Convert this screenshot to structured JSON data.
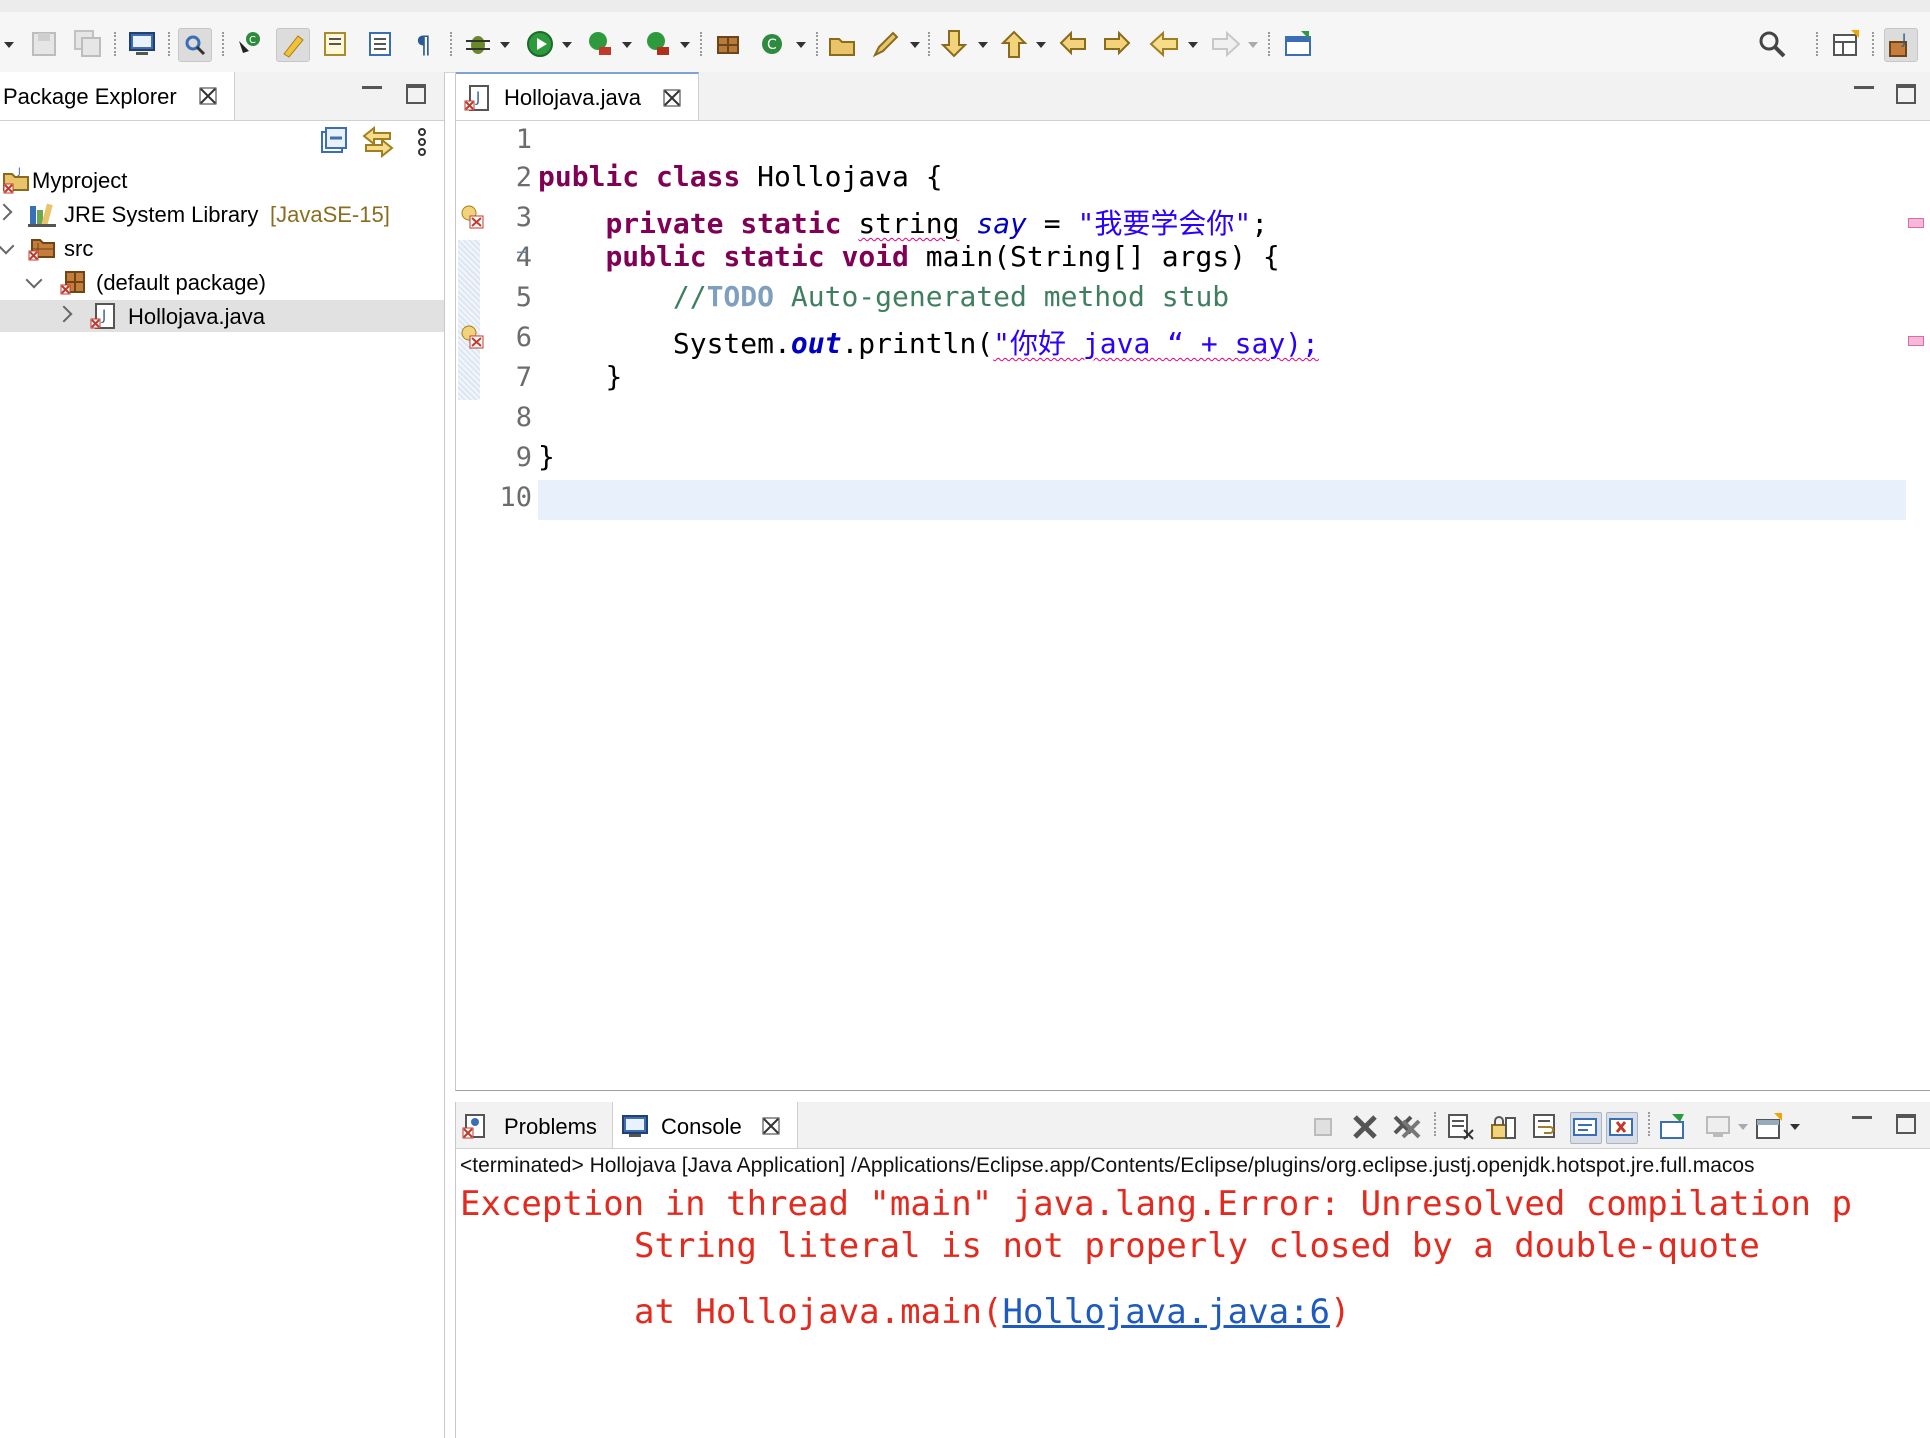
{
  "left_panel": {
    "tab_title": "Package Explorer",
    "tree": [
      {
        "label": "Myproject",
        "suffix": ""
      },
      {
        "label": "JRE System Library",
        "suffix": "[JavaSE-15]"
      },
      {
        "label": "src",
        "suffix": ""
      },
      {
        "label": "(default package)",
        "suffix": ""
      },
      {
        "label": "Hollojava.java",
        "suffix": ""
      }
    ]
  },
  "editor": {
    "tab_title": "Hollojava.java",
    "line_numbers": [
      "1",
      "2",
      "3",
      "4",
      "5",
      "6",
      "7",
      "8",
      "9",
      "10"
    ],
    "fold_marker": "−",
    "line2": {
      "kw1": "public",
      "kw2": "class",
      "rest": " Hollojava {"
    },
    "line3": {
      "kw1": "private",
      "kw2": "static",
      "type": "string",
      "field": "say",
      "op": " = ",
      "string": "\"我要学会你\"",
      "end": ";"
    },
    "line4": {
      "kw1": "public",
      "kw2": "static",
      "kw3": "void",
      "rest": " main(String[] args) {"
    },
    "line5": {
      "comment_start": "//",
      "todo": "TODO",
      "comment": " Auto-generated method stub"
    },
    "line6": {
      "prefix": "System.",
      "field": "out",
      "call": ".println(",
      "bad": "\"你好 java “ + say);"
    },
    "line7": "}",
    "line9": "}"
  },
  "console": {
    "tabs": [
      "Problems",
      "Console"
    ],
    "terminated": "<terminated> Hollojava [Java Application] /Applications/Eclipse.app/Contents/Eclipse/plugins/org.eclipse.justj.openjdk.hotspot.jre.full.macos",
    "error_line1": "Exception in thread \"main\" java.lang.Error: Unresolved compilation p",
    "error_line2": "String literal is not properly closed by a double-quote",
    "error_at": "at Hollojava.main(",
    "error_link": "Hollojava.java:6",
    "error_end": ")"
  },
  "colors": {
    "keyword": "#7f0055",
    "field": "#0000c0",
    "string": "#2a00ff",
    "comment": "#3f7f5f",
    "error_text": "#e22a1e",
    "link": "#1f5bbf",
    "current_line": "#e8f1fb"
  },
  "icons": {
    "toolbar": [
      "save-icon",
      "save-all-icon",
      "terminal-icon",
      "link-icon",
      "new-class-icon",
      "highlight-icon",
      "toggle-mark-icon",
      "block-select-icon",
      "pilcrow-icon",
      "debug-icon",
      "run-icon",
      "coverage-icon",
      "run-external-icon",
      "new-java-project-icon",
      "refresh-icon",
      "open-type-icon",
      "pencil-icon",
      "next-annotation-icon",
      "prev-annotation-icon",
      "last-edit-icon",
      "forward-edit-icon",
      "back-icon",
      "forward-icon",
      "open-task-icon",
      "search-icon",
      "open-perspective-icon",
      "java-perspective-icon"
    ]
  }
}
